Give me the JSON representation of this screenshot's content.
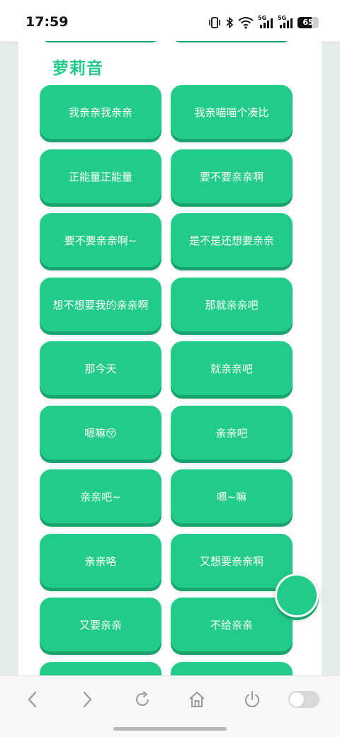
{
  "status_bar": {
    "time": "17:59",
    "battery_level": "65",
    "battery_fraction": 0.65,
    "signal_labels": [
      "5G",
      "5G"
    ]
  },
  "section": {
    "title": "萝莉音"
  },
  "sounds": [
    {
      "label": "我亲亲我亲亲"
    },
    {
      "label": "我亲喵喵个凑比"
    },
    {
      "label": "正能量正能量"
    },
    {
      "label": "要不要亲亲啊"
    },
    {
      "label": "要不要亲亲啊~"
    },
    {
      "label": "是不是还想要亲亲"
    },
    {
      "label": "想不想要我的亲亲啊"
    },
    {
      "label": "那就亲亲吧"
    },
    {
      "label": "那今天"
    },
    {
      "label": "就亲亲吧"
    },
    {
      "label": "嗯嘛😚"
    },
    {
      "label": "亲亲吧"
    },
    {
      "label": "亲亲吧~"
    },
    {
      "label": "嗯~嘛"
    },
    {
      "label": "亲亲咯"
    },
    {
      "label": "又想要亲亲啊"
    },
    {
      "label": "又要亲亲"
    },
    {
      "label": "不给亲亲"
    },
    {
      "label": ""
    },
    {
      "label": ""
    }
  ],
  "colors": {
    "accent": "#22cc88",
    "accent_shadow": "#17a56d",
    "page_bg": "#e4ece9"
  },
  "toolbar": {
    "icons": [
      "back-icon",
      "forward-icon",
      "refresh-icon",
      "home-icon",
      "power-icon",
      "toggle-switch"
    ],
    "toggle_on": false
  }
}
